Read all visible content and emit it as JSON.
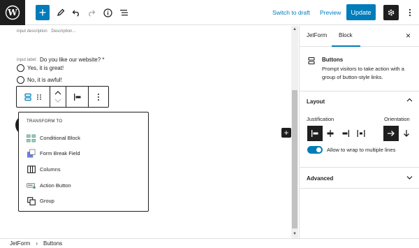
{
  "topbar": {
    "save_draft": "Switch to draft",
    "preview": "Preview",
    "update": "Update"
  },
  "editor": {
    "desc_label": "input description",
    "desc_placeholder": "Description...",
    "input_label_label": "input label:",
    "question": "Do you like our website? *",
    "options": [
      "Yes, it is great!",
      "No, it is awful!"
    ]
  },
  "transform": {
    "title": "TRANSFORM TO",
    "items": [
      "Conditional Block",
      "Form Break Field",
      "Columns",
      "Action Button",
      "Group"
    ]
  },
  "sidebar": {
    "tabs": [
      "JetForm",
      "Block"
    ],
    "block_title": "Buttons",
    "block_desc": "Prompt visitors to take action with a group of button-style links.",
    "layout_title": "Layout",
    "justification_label": "Justification",
    "orientation_label": "Orientation",
    "wrap_label": "Allow to wrap to multiple lines",
    "advanced_title": "Advanced"
  },
  "footer": {
    "breadcrumb": [
      "JetForm",
      "Buttons"
    ]
  },
  "colors": {
    "accent": "#007cba",
    "dark": "#1e1e1e"
  }
}
